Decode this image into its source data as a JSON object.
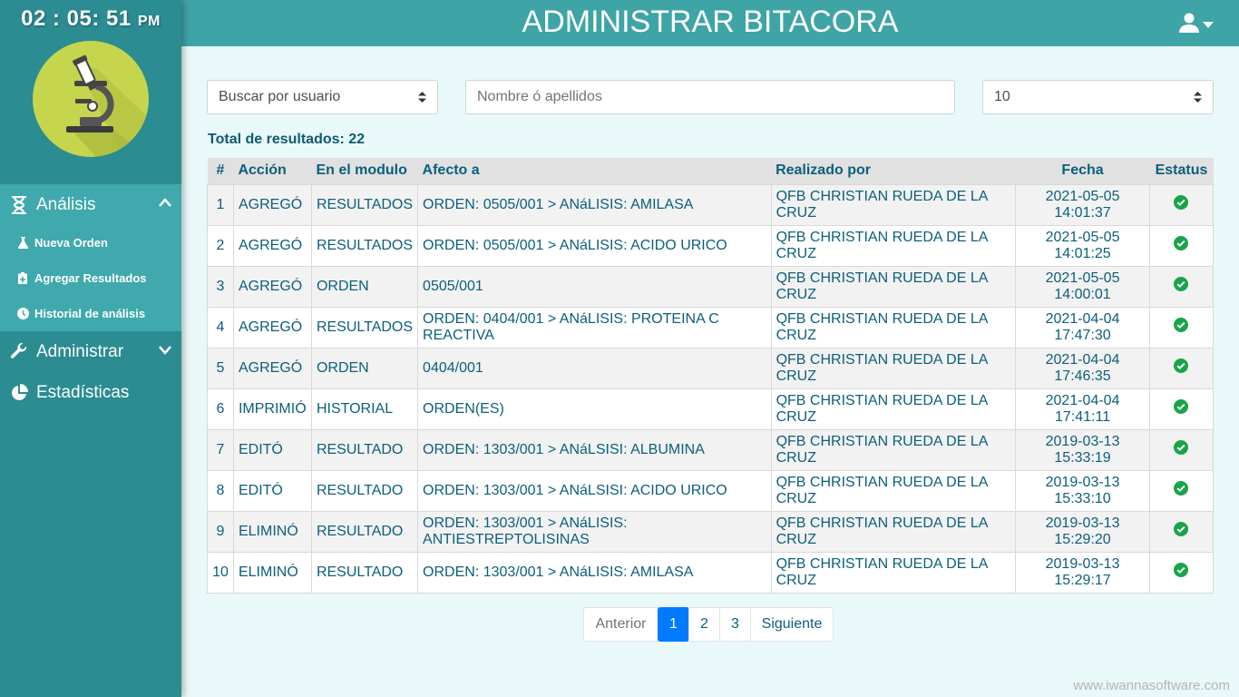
{
  "clock": {
    "time": "02 : 05: 51",
    "ampm": "PM"
  },
  "header": {
    "title": "ADMINISTRAR BITACORA"
  },
  "sidebar": {
    "analisis": {
      "label": "Análisis",
      "items": [
        {
          "label": "Nueva Orden",
          "icon": "flask-icon"
        },
        {
          "label": "Agregar Resultados",
          "icon": "clipboard-plus-icon"
        },
        {
          "label": "Historial de análisis",
          "icon": "clock-icon"
        }
      ]
    },
    "administrar": {
      "label": "Administrar"
    },
    "estadisticas": {
      "label": "Estadísticas"
    }
  },
  "filters": {
    "search_by": "Buscar por usuario",
    "name_placeholder": "Nombre ó apellidos",
    "page_size": "10"
  },
  "results": {
    "total_label": "Total de resultados: 22"
  },
  "table": {
    "headers": {
      "num": "#",
      "accion": "Acción",
      "modulo": "En el modulo",
      "afecto": "Afecto a",
      "realizado": "Realizado por",
      "fecha": "Fecha",
      "estatus": "Estatus"
    },
    "rows": [
      {
        "num": "1",
        "accion": "AGREGÓ",
        "modulo": "RESULTADOS",
        "afecto": "ORDEN: 0505/001 > ANáLISIS: AMILASA",
        "realizado": "QFB CHRISTIAN RUEDA DE LA CRUZ",
        "fecha": "2021-05-05",
        "hora": "14:01:37"
      },
      {
        "num": "2",
        "accion": "AGREGÓ",
        "modulo": "RESULTADOS",
        "afecto": "ORDEN: 0505/001 > ANáLISIS: ACIDO URICO",
        "realizado": "QFB CHRISTIAN RUEDA DE LA CRUZ",
        "fecha": "2021-05-05",
        "hora": "14:01:25"
      },
      {
        "num": "3",
        "accion": "AGREGÓ",
        "modulo": "ORDEN",
        "afecto": "0505/001",
        "realizado": "QFB CHRISTIAN RUEDA DE LA CRUZ",
        "fecha": "2021-05-05",
        "hora": "14:00:01"
      },
      {
        "num": "4",
        "accion": "AGREGÓ",
        "modulo": "RESULTADOS",
        "afecto": "ORDEN: 0404/001 > ANáLISIS: PROTEINA C REACTIVA",
        "realizado": "QFB CHRISTIAN RUEDA DE LA CRUZ",
        "fecha": "2021-04-04",
        "hora": "17:47:30"
      },
      {
        "num": "5",
        "accion": "AGREGÓ",
        "modulo": "ORDEN",
        "afecto": "0404/001",
        "realizado": "QFB CHRISTIAN RUEDA DE LA CRUZ",
        "fecha": "2021-04-04",
        "hora": "17:46:35"
      },
      {
        "num": "6",
        "accion": "IMPRIMIÓ",
        "modulo": "HISTORIAL",
        "afecto": "ORDEN(ES)",
        "realizado": "QFB CHRISTIAN RUEDA DE LA CRUZ",
        "fecha": "2021-04-04",
        "hora": "17:41:11"
      },
      {
        "num": "7",
        "accion": "EDITÓ",
        "modulo": "RESULTADO",
        "afecto": "ORDEN: 1303/001 > ANáLSISI: ALBUMINA",
        "realizado": "QFB CHRISTIAN RUEDA DE LA CRUZ",
        "fecha": "2019-03-13",
        "hora": "15:33:19"
      },
      {
        "num": "8",
        "accion": "EDITÓ",
        "modulo": "RESULTADO",
        "afecto": "ORDEN: 1303/001 > ANáLSISI: ACIDO URICO",
        "realizado": "QFB CHRISTIAN RUEDA DE LA CRUZ",
        "fecha": "2019-03-13",
        "hora": "15:33:10"
      },
      {
        "num": "9",
        "accion": "ELIMINÓ",
        "modulo": "RESULTADO",
        "afecto": "ORDEN: 1303/001 > ANáLISIS: ANTIESTREPTOLISINAS",
        "realizado": "QFB CHRISTIAN RUEDA DE LA CRUZ",
        "fecha": "2019-03-13",
        "hora": "15:29:20"
      },
      {
        "num": "10",
        "accion": "ELIMINÓ",
        "modulo": "RESULTADO",
        "afecto": "ORDEN: 1303/001 > ANáLISIS: AMILASA",
        "realizado": "QFB CHRISTIAN RUEDA DE LA CRUZ",
        "fecha": "2019-03-13",
        "hora": "15:29:17"
      }
    ]
  },
  "pagination": {
    "prev": "Anterior",
    "pages": [
      "1",
      "2",
      "3"
    ],
    "next": "Siguiente",
    "current": "1"
  },
  "watermark": "www.iwannasoftware.com",
  "colors": {
    "sidebar": "#2b8c91",
    "header": "#3ea4a6",
    "status_ok": "#18a54a",
    "active_page": "#007bff",
    "text": "#0b5f7c"
  }
}
